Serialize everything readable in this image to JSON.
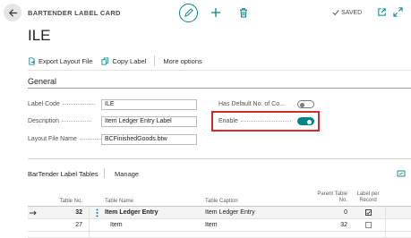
{
  "header": {
    "caption": "BARTENDER LABEL CARD",
    "status": "SAVED"
  },
  "page_title": "ILE",
  "actions": {
    "export_layout": "Export Layout File",
    "copy_label": "Copy Label",
    "more_options": "More options"
  },
  "general": {
    "title": "General",
    "label_code_label": "Label Code",
    "label_code_value": "ILE",
    "description_label": "Description",
    "description_value": "Item Ledger Entry Label",
    "layout_file_label": "Layout File Name",
    "layout_file_value": "BCFinishedGoods.btw",
    "has_default_label": "Has Default No. of Co...",
    "has_default_value": false,
    "enable_label": "Enable",
    "enable_value": true
  },
  "part": {
    "title": "BarTender Label Tables",
    "manage": "Manage"
  },
  "table": {
    "headers": {
      "table_no": "Table No.",
      "table_name": "Table Name",
      "table_caption": "Table Caption",
      "parent_table_no_1": "Parent Table",
      "parent_table_no_2": "No.",
      "label_per_record_1": "Label per",
      "label_per_record_2": "Record"
    },
    "rows": [
      {
        "table_no": "32",
        "table_name": "Item Ledger Entry",
        "table_caption": "Item Ledger Entry",
        "parent_table_no": "0",
        "label_per_record": true
      },
      {
        "table_no": "27",
        "table_name": "Item",
        "table_caption": "Item",
        "parent_table_no": "32",
        "label_per_record": false
      }
    ]
  },
  "colors": {
    "accent": "#008489",
    "highlight": "#d42b2b"
  }
}
